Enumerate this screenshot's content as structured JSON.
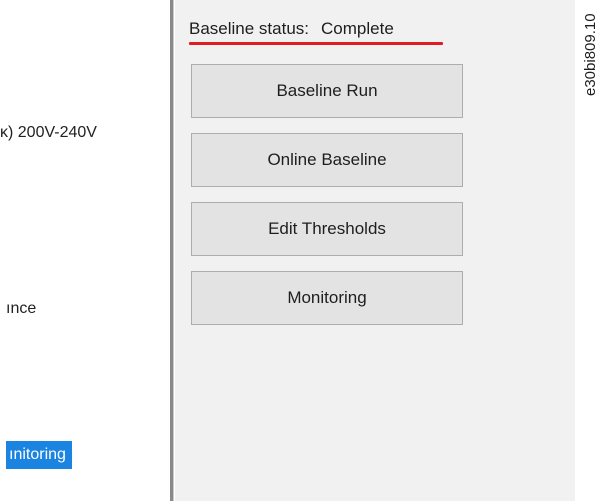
{
  "left_panel": {
    "voltage_text": "ĸ) 200V-240V",
    "ance_text": "ınce",
    "monitoring_selected": "ınitoring"
  },
  "baseline_panel": {
    "status_label": "Baseline status:",
    "status_value": "Complete",
    "underline_color": "#e01b24",
    "buttons": [
      {
        "label": "Baseline Run"
      },
      {
        "label": "Online Baseline"
      },
      {
        "label": "Edit Thresholds"
      },
      {
        "label": "Monitoring"
      }
    ]
  },
  "figure_code": "e30bi809.10",
  "colors": {
    "selection_highlight": "#1b83e0",
    "panel_background": "#f1f1f1",
    "button_background": "#e3e3e3"
  }
}
